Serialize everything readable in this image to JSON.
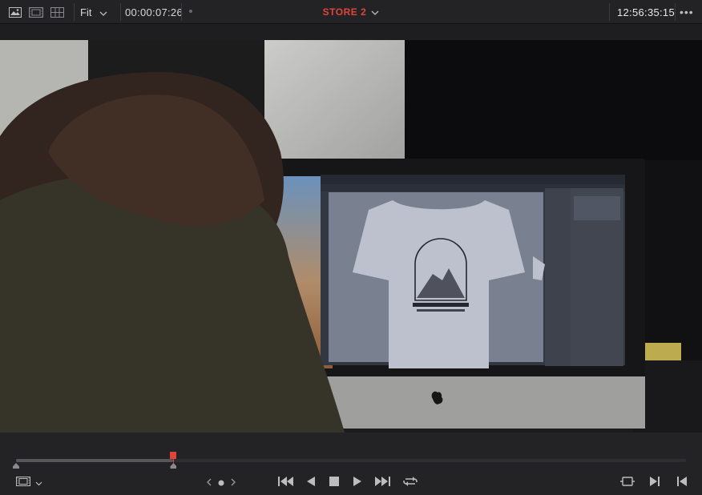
{
  "toolbar": {
    "view_icons": [
      "image-view-icon",
      "cinema-view-icon",
      "grid-view-icon"
    ],
    "zoom_label": "Fit",
    "timecode": "00:00:07:26",
    "title": "STORE 2",
    "clock": "12:56:35:15",
    "more_label": "•••"
  },
  "playback": {
    "position": 0.235
  },
  "colors": {
    "accent": "#e0443a",
    "background": "#232326"
  }
}
